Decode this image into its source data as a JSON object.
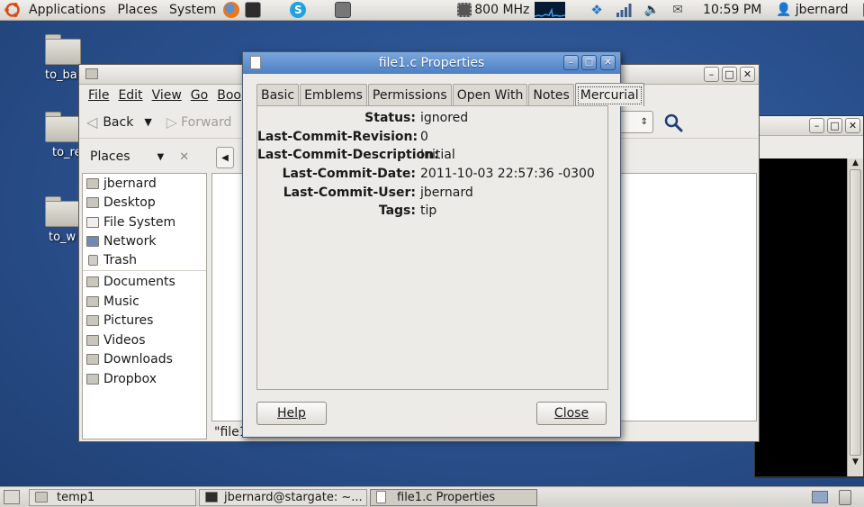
{
  "top_panel": {
    "menus": [
      "Applications",
      "Places",
      "System"
    ],
    "cpu_freq": "800 MHz",
    "clock": "10:59 PM",
    "user": "jbernard"
  },
  "desktop_icons": [
    {
      "label": "to_ba"
    },
    {
      "label": "to_re"
    },
    {
      "label": "to_w"
    }
  ],
  "file_manager": {
    "menu": [
      "File",
      "Edit",
      "View",
      "Go",
      "Boo"
    ],
    "back_label": "Back",
    "forward_label": "Forward",
    "places_label": "Places",
    "places": [
      "jbernard",
      "Desktop",
      "File System",
      "Network",
      "Trash"
    ],
    "bookmarks": [
      "Documents",
      "Music",
      "Pictures",
      "Videos",
      "Downloads",
      "Dropbox"
    ],
    "status_text": "\"file1"
  },
  "dialog": {
    "title": "file1.c Properties",
    "tabs": [
      "Basic",
      "Emblems",
      "Permissions",
      "Open With",
      "Notes",
      "Mercurial"
    ],
    "selected_tab": "Mercurial",
    "rows": [
      {
        "label": "Status:",
        "value": "ignored"
      },
      {
        "label": "Last-Commit-Revision:",
        "value": "0"
      },
      {
        "label": "Last-Commit-Description:",
        "value": "Initial"
      },
      {
        "label": "Last-Commit-Date:",
        "value": "2011-10-03 22:57:36 -0300"
      },
      {
        "label": "Last-Commit-User:",
        "value": "jbernard"
      },
      {
        "label": "Tags:",
        "value": "tip"
      }
    ],
    "help_label": "Help",
    "close_label": "Close"
  },
  "taskbar": {
    "tasks": [
      "temp1",
      "jbernard@stargate: ~...",
      "file1.c Properties"
    ]
  },
  "colors": {
    "desktop_blue": "#2b5290",
    "dialog_title": "#4d7fc2",
    "panel_bg": "#edebe7"
  }
}
